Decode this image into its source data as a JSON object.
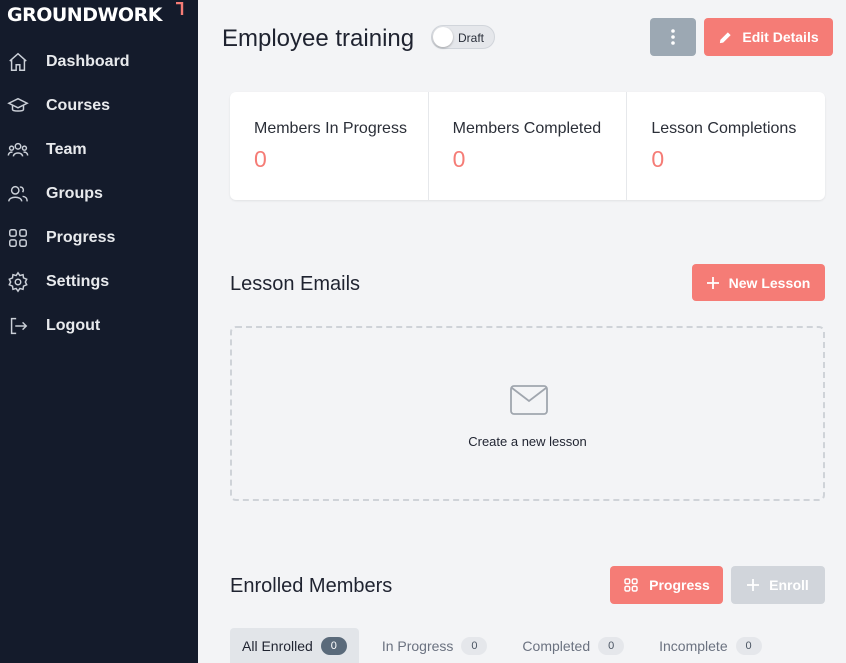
{
  "brand": {
    "name": "GROUNDWORK",
    "accent": "#f57c76"
  },
  "sidebar": {
    "items": [
      {
        "label": "Dashboard",
        "icon": "home-icon"
      },
      {
        "label": "Courses",
        "icon": "graduation-cap-icon"
      },
      {
        "label": "Team",
        "icon": "team-icon"
      },
      {
        "label": "Groups",
        "icon": "groups-icon"
      },
      {
        "label": "Progress",
        "icon": "grid-icon"
      },
      {
        "label": "Settings",
        "icon": "gear-icon"
      },
      {
        "label": "Logout",
        "icon": "logout-icon"
      }
    ]
  },
  "header": {
    "title": "Employee training",
    "status_toggle": "Draft",
    "edit_label": "Edit Details"
  },
  "stats": [
    {
      "label": "Members In Progress",
      "value": "0"
    },
    {
      "label": "Members Completed",
      "value": "0"
    },
    {
      "label": "Lesson Completions",
      "value": "0"
    }
  ],
  "lessons": {
    "title": "Lesson Emails",
    "new_label": "New Lesson",
    "empty_text": "Create a new lesson"
  },
  "members": {
    "title": "Enrolled Members",
    "progress_label": "Progress",
    "enroll_label": "Enroll",
    "tabs": [
      {
        "label": "All Enrolled",
        "count": "0"
      },
      {
        "label": "In Progress",
        "count": "0"
      },
      {
        "label": "Completed",
        "count": "0"
      },
      {
        "label": "Incomplete",
        "count": "0"
      }
    ]
  }
}
